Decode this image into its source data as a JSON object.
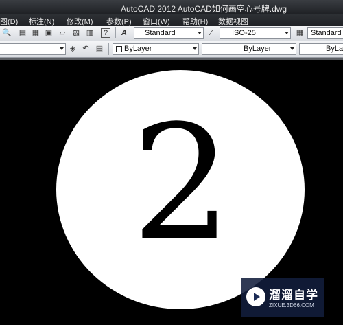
{
  "window": {
    "title": "AutoCAD 2012    AutoCAD如何画空心号牌.dwg"
  },
  "menu": {
    "items": [
      {
        "label": "图(D)"
      },
      {
        "label": "标注(N)"
      },
      {
        "label": "修改(M)"
      },
      {
        "label": "参数(P)"
      },
      {
        "label": "窗口(W)"
      },
      {
        "label": "帮助(H)"
      },
      {
        "label": "数据视图"
      }
    ]
  },
  "toolbar_styles": {
    "text_style": "Standard",
    "dim_style": "ISO-25",
    "table_style": "Standard"
  },
  "toolbar_properties": {
    "color": "ByLayer",
    "linetype": "ByLayer",
    "lineweight": "ByLay"
  },
  "canvas": {
    "text": "2"
  },
  "watermark": {
    "brand": "溜溜自学",
    "url": "ZIXUE.3D66.COM"
  },
  "icons": [
    "zoom-icon",
    "layer-icon",
    "properties-icon",
    "match-icon",
    "sheet-icon",
    "calculator-icon",
    "help-icon",
    "text-style-icon",
    "dim-style-icon",
    "table-style-icon",
    "layer-state-icon",
    "layer-previous-icon",
    "play-icon"
  ],
  "colors": {
    "canvas_bg": "#000000",
    "circle_fill": "#ffffff",
    "toolbar": "#e4e6ea",
    "titlebar": "#2b2e33"
  }
}
